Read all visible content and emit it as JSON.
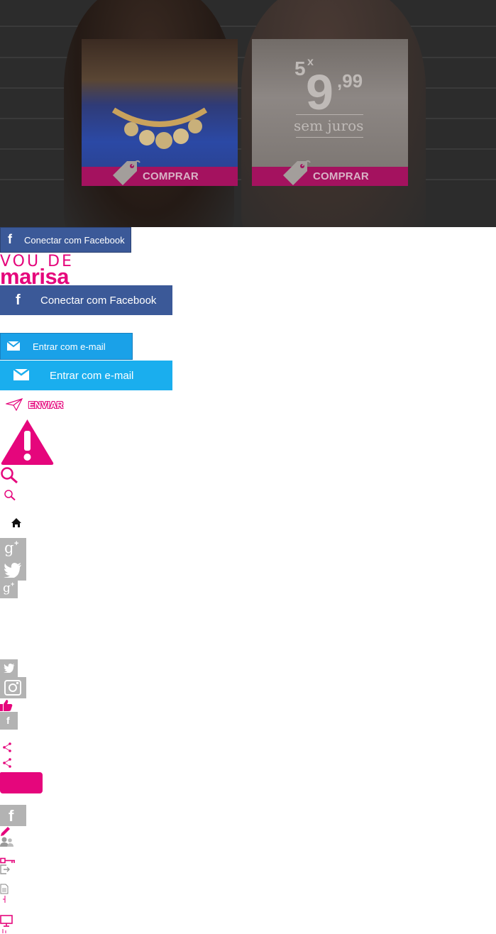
{
  "hero": {
    "product1": {
      "buy_label": "COMPRAR"
    },
    "product2": {
      "buy_label": "COMPRAR",
      "installments": "5",
      "installments_x": "x",
      "price_int": "9",
      "price_dec": ",99",
      "price_note": "sem juros"
    }
  },
  "facebook": {
    "small_label": "Conectar com Facebook",
    "big_label": "Conectar com Facebook",
    "glyph": "f"
  },
  "logo": {
    "line1": "VOU DE",
    "line2": "marisa"
  },
  "email": {
    "small_label": "Entrar com e-mail",
    "big_label": "Entrar com e-mail"
  },
  "send": {
    "label": "ENVIAR"
  },
  "icons": {
    "warning": "warning-icon",
    "search_large": "search-icon",
    "search_small": "search-icon",
    "home": "home-icon",
    "google_plus": "google-plus-icon",
    "twitter": "twitter-icon",
    "instagram": "instagram-icon",
    "like": "thumbs-up-icon",
    "share": "share-icon",
    "edit": "pencil-icon",
    "users": "users-icon",
    "key": "key-icon",
    "logout": "logout-icon",
    "document": "document-icon",
    "monitor": "monitor-icon"
  },
  "colors": {
    "brand_pink": "#e5067c",
    "facebook_blue": "#3b5998",
    "email_blue": "#1aaeee",
    "social_grey": "#b3b3b3"
  }
}
